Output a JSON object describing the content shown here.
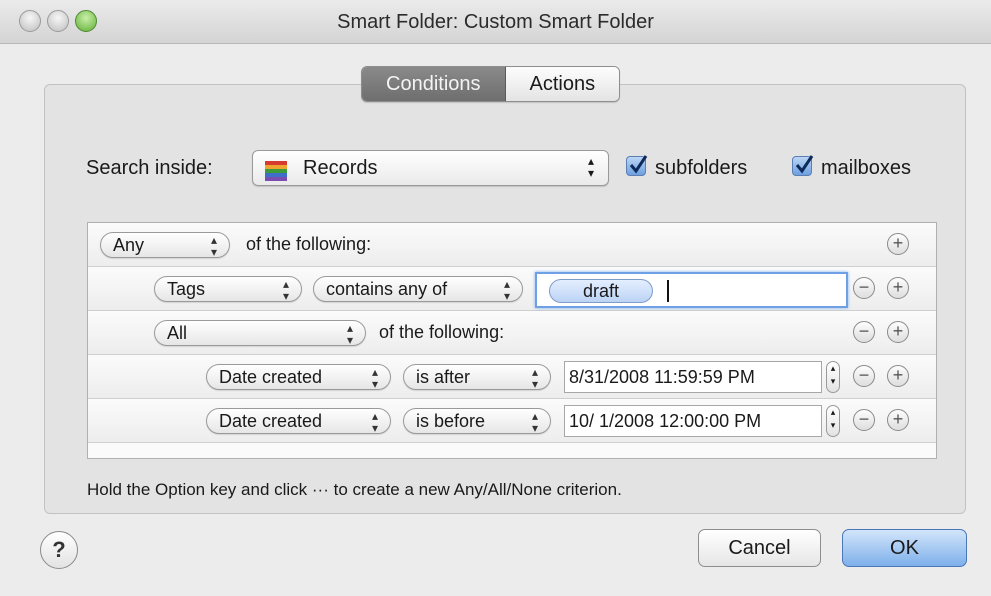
{
  "window": {
    "title": "Smart Folder: Custom Smart Folder"
  },
  "tabs": [
    {
      "label": "Conditions",
      "selected": true
    },
    {
      "label": "Actions",
      "selected": false
    }
  ],
  "search_inside": {
    "label": "Search inside:",
    "icon": "records-database-icon",
    "value": "Records",
    "subfolders": {
      "label": "subfolders",
      "checked": true
    },
    "mailboxes": {
      "label": "mailboxes",
      "checked": true
    }
  },
  "criteria": {
    "match": "Any",
    "match_suffix": "of the following:",
    "rule1": {
      "field": "Tags",
      "operator": "contains any of",
      "token": "draft"
    },
    "group": {
      "match": "All",
      "match_suffix": "of the following:",
      "rule1": {
        "field": "Date created",
        "operator": "is after",
        "value": "8/31/2008 11:59:59 PM"
      },
      "rule2": {
        "field": "Date created",
        "operator": "is before",
        "value": "10/ 1/2008 12:00:00 PM"
      }
    }
  },
  "hint": "Hold the Option key and click ··· to create a new Any/All/None criterion.",
  "buttons": {
    "help": "?",
    "cancel": "Cancel",
    "ok": "OK"
  },
  "colors": {
    "accent": "#7eb0ea",
    "focus_ring": "#6fa0e6",
    "token": "#bcd3f5"
  },
  "symbols": {
    "add": "+",
    "remove": "−",
    "popup_arrows": "▴▾"
  }
}
